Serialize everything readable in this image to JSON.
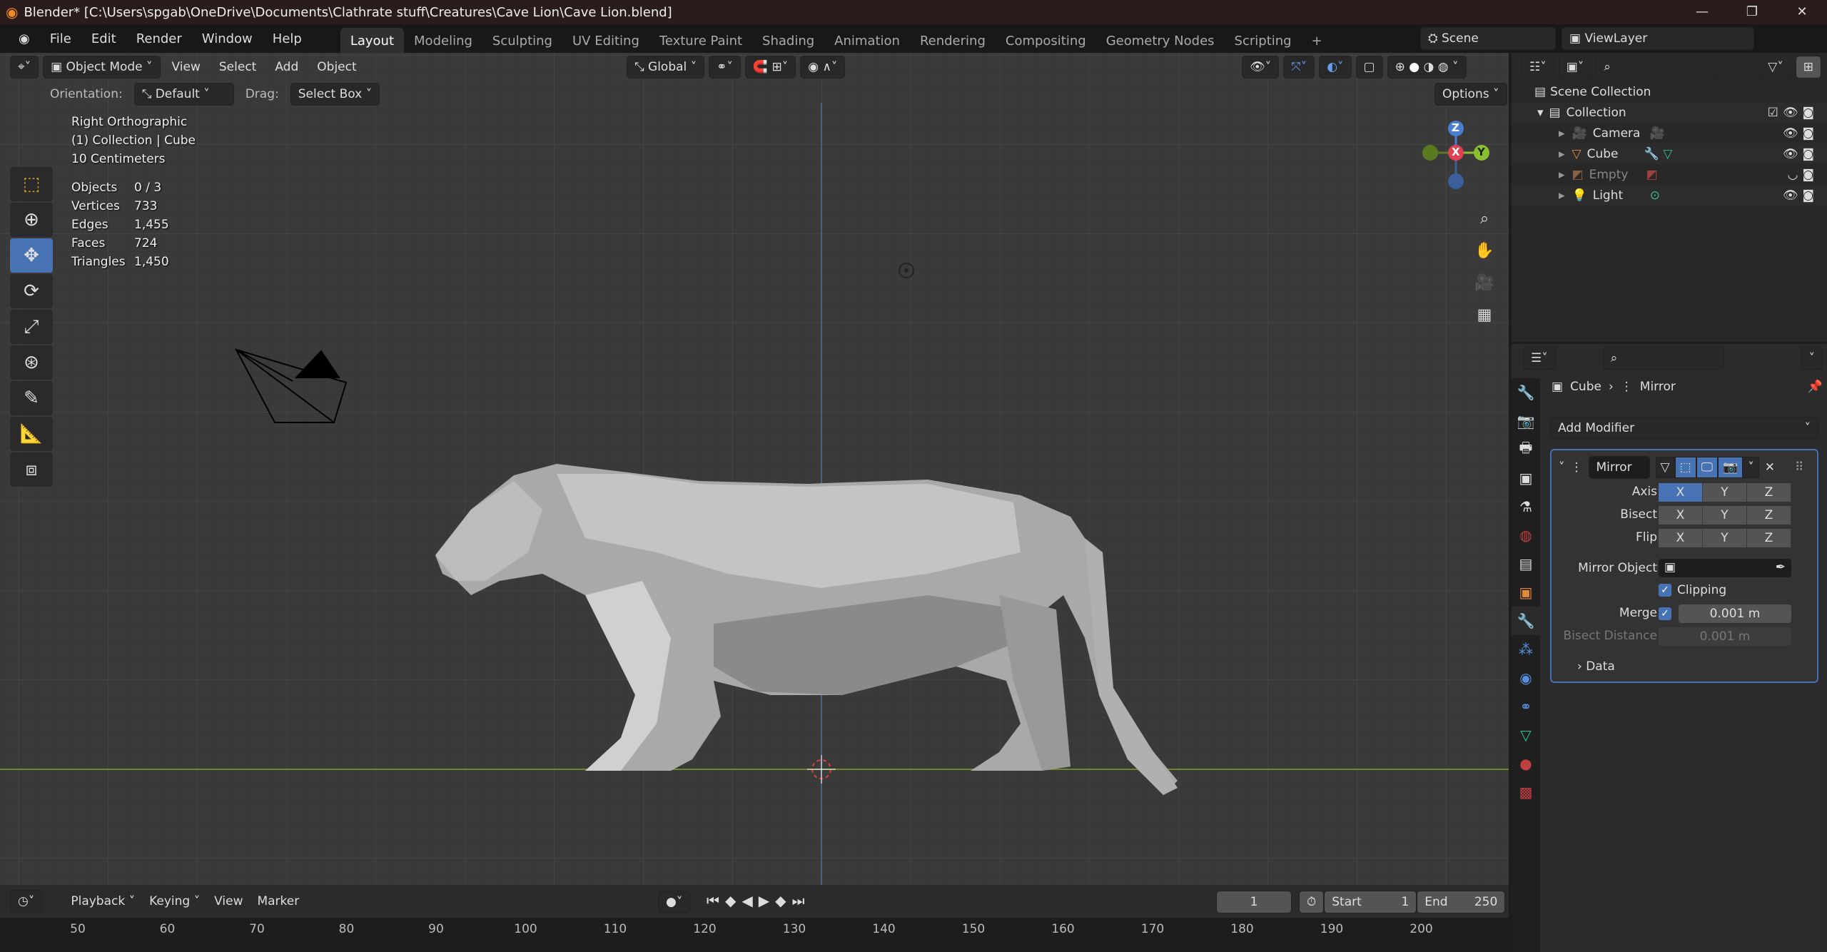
{
  "window": {
    "title": "Blender* [C:\\Users\\spgab\\OneDrive\\Documents\\Clathrate stuff\\Creatures\\Cave Lion\\Cave Lion.blend]",
    "minimize": "—",
    "maximize": "❐",
    "close": "✕"
  },
  "menu": [
    "File",
    "Edit",
    "Render",
    "Window",
    "Help"
  ],
  "workspaces": [
    "Layout",
    "Modeling",
    "Sculpting",
    "UV Editing",
    "Texture Paint",
    "Shading",
    "Animation",
    "Rendering",
    "Compositing",
    "Geometry Nodes",
    "Scripting",
    "+"
  ],
  "scene": {
    "name": "Scene",
    "view_layer": "ViewLayer"
  },
  "viewport_header": {
    "mode": "Object Mode",
    "view": "View",
    "select": "Select",
    "add": "Add",
    "object": "Object",
    "transform": "Global"
  },
  "tool_settings": {
    "orientation_label": "Orientation:",
    "orientation": "Default",
    "drag_label": "Drag:",
    "drag": "Select Box",
    "options": "Options"
  },
  "overlay": {
    "view_name": "Right Orthographic",
    "collection": "(1) Collection | Cube",
    "scale": "10 Centimeters",
    "stats": [
      {
        "k": "Objects",
        "v": "0 / 3"
      },
      {
        "k": "Vertices",
        "v": "733"
      },
      {
        "k": "Edges",
        "v": "1,455"
      },
      {
        "k": "Faces",
        "v": "724"
      },
      {
        "k": "Triangles",
        "v": "1,450"
      }
    ]
  },
  "gizmo": {
    "z": "Z",
    "x": "X",
    "y": "Y"
  },
  "outliner": {
    "root": "Scene Collection",
    "collection": "Collection",
    "items": [
      {
        "name": "Camera",
        "icon": "camera-icon",
        "color": "#e08a3a"
      },
      {
        "name": "Cube",
        "icon": "mesh-icon",
        "color": "#e08a3a"
      },
      {
        "name": "Empty",
        "icon": "empty-icon",
        "color": "#8a6040"
      },
      {
        "name": "Light",
        "icon": "light-icon",
        "color": "#e08a3a"
      }
    ]
  },
  "properties": {
    "object": "Cube",
    "modifier": "Mirror",
    "add_modifier": "Add Modifier",
    "mod_name": "Mirror",
    "axis_label": "Axis",
    "bisect_label": "Bisect",
    "flip_label": "Flip",
    "axes": [
      "X",
      "Y",
      "Z"
    ],
    "axis_active": "X",
    "mirror_object_label": "Mirror Object",
    "clipping": "Clipping",
    "merge_label": "Merge",
    "merge_value": "0.001 m",
    "bisect_distance_label": "Bisect Distance",
    "bisect_distance_value": "0.001 m",
    "data": "Data",
    "accent": "#4772b3"
  },
  "timeline": {
    "playback": "Playback",
    "keying": "Keying",
    "view": "View",
    "marker": "Marker",
    "current_frame": "1",
    "start_label": "Start",
    "start": "1",
    "end_label": "End",
    "end": "250",
    "ruler": [
      "50",
      "60",
      "70",
      "80",
      "90",
      "100",
      "110",
      "120",
      "130",
      "140",
      "150",
      "160",
      "170",
      "180",
      "190",
      "200"
    ]
  }
}
